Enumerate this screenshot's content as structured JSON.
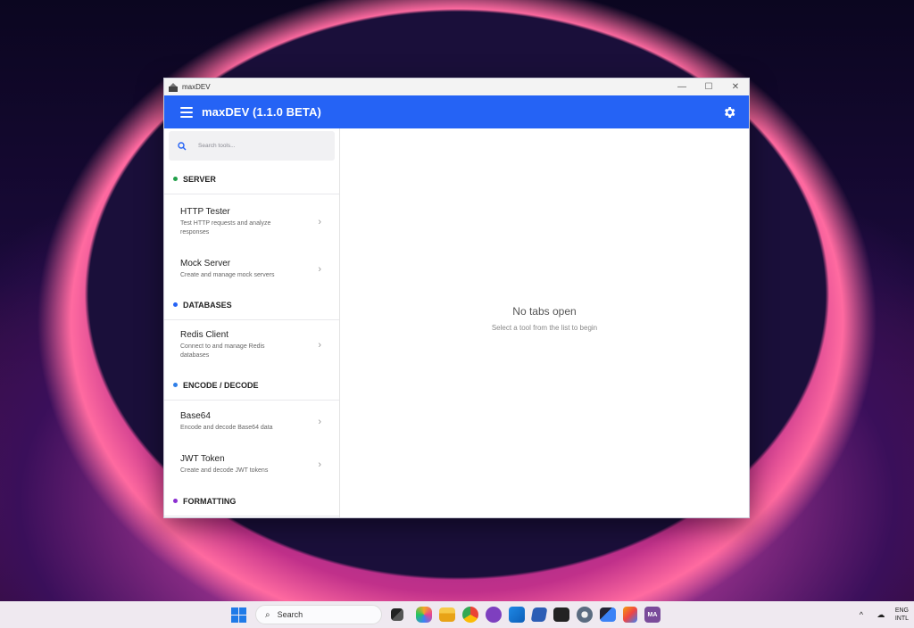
{
  "window": {
    "title": "maxDEV",
    "controls": {
      "minimize": "—",
      "maximize": "☐",
      "close": "✕"
    }
  },
  "appbar": {
    "title": "maxDEV (1.1.0 BETA)",
    "menu_icon": "hamburger-icon",
    "settings_icon": "gear-icon",
    "color": "#2563f5"
  },
  "sidebar": {
    "search": {
      "placeholder": "Search tools..."
    },
    "sections": [
      {
        "label": "SERVER",
        "color": "#22a04a"
      },
      {
        "label": "DATABASES",
        "color": "#2563f5"
      },
      {
        "label": "ENCODE / DECODE",
        "color": "#2f7fe8"
      },
      {
        "label": "FORMATTING",
        "color": "#8b2fd0"
      }
    ],
    "items": [
      {
        "name": "HTTP Tester",
        "desc": "Test HTTP requests and analyze responses"
      },
      {
        "name": "Mock Server",
        "desc": "Create and manage mock servers"
      },
      {
        "name": "Redis Client",
        "desc": "Connect to and manage Redis databases"
      },
      {
        "name": "Base64",
        "desc": "Encode and decode Base64 data"
      },
      {
        "name": "JWT Token",
        "desc": "Create and decode JWT tokens"
      }
    ],
    "chevron": "›"
  },
  "main": {
    "heading": "No tabs open",
    "subheading": "Select a tool from the list to begin"
  },
  "taskbar": {
    "search_label": "Search",
    "icons": [
      "start-icon",
      "taskview-icon",
      "copilot-icon",
      "file-explorer-icon",
      "chrome-icon",
      "github-desktop-icon",
      "vscode-icon",
      "powershell-icon",
      "terminal-icon",
      "settings-icon",
      "network-app-icon",
      "paint-icon",
      "maxdev-taskbar-icon"
    ],
    "maxdev_label": "MA",
    "tray": {
      "lang_line1": "ENG",
      "lang_line2": "INTL",
      "chevron": "^",
      "cloud": "☁"
    }
  }
}
